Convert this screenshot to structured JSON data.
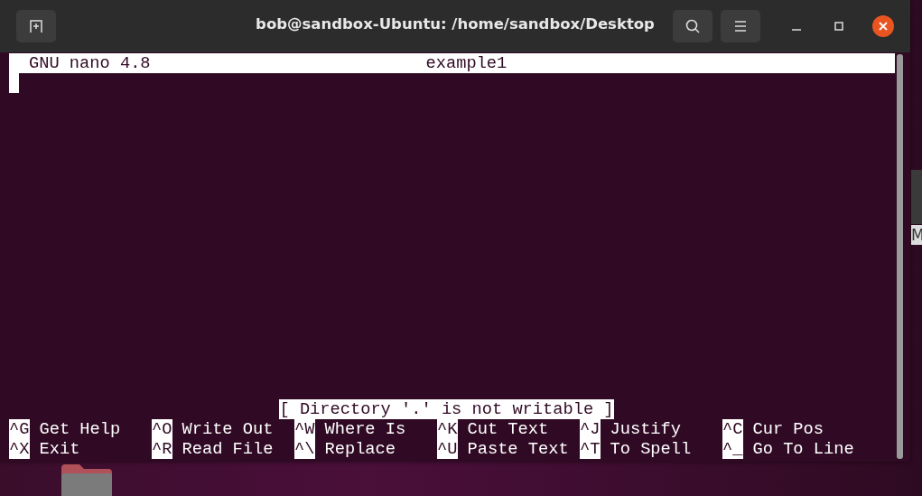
{
  "window": {
    "title": "bob@sandbox-Ubuntu: /home/sandbox/Desktop"
  },
  "nano_header": {
    "version": "GNU nano 4.8",
    "filename": "example1"
  },
  "status_message": "[ Directory '.' is not writable ]",
  "shortcut_rows": [
    [
      {
        "key": "^G",
        "label": "Get Help"
      },
      {
        "key": "^O",
        "label": "Write Out"
      },
      {
        "key": "^W",
        "label": "Where Is"
      },
      {
        "key": "^K",
        "label": "Cut Text"
      },
      {
        "key": "^J",
        "label": "Justify"
      },
      {
        "key": "^C",
        "label": "Cur Pos"
      }
    ],
    [
      {
        "key": "^X",
        "label": "Exit"
      },
      {
        "key": "^R",
        "label": "Read File"
      },
      {
        "key": "^\\",
        "label": "Replace"
      },
      {
        "key": "^U",
        "label": "Paste Text"
      },
      {
        "key": "^T",
        "label": "To Spell"
      },
      {
        "key": "^_",
        "label": "Go To Line"
      }
    ]
  ],
  "background_window": {
    "text": "M"
  }
}
